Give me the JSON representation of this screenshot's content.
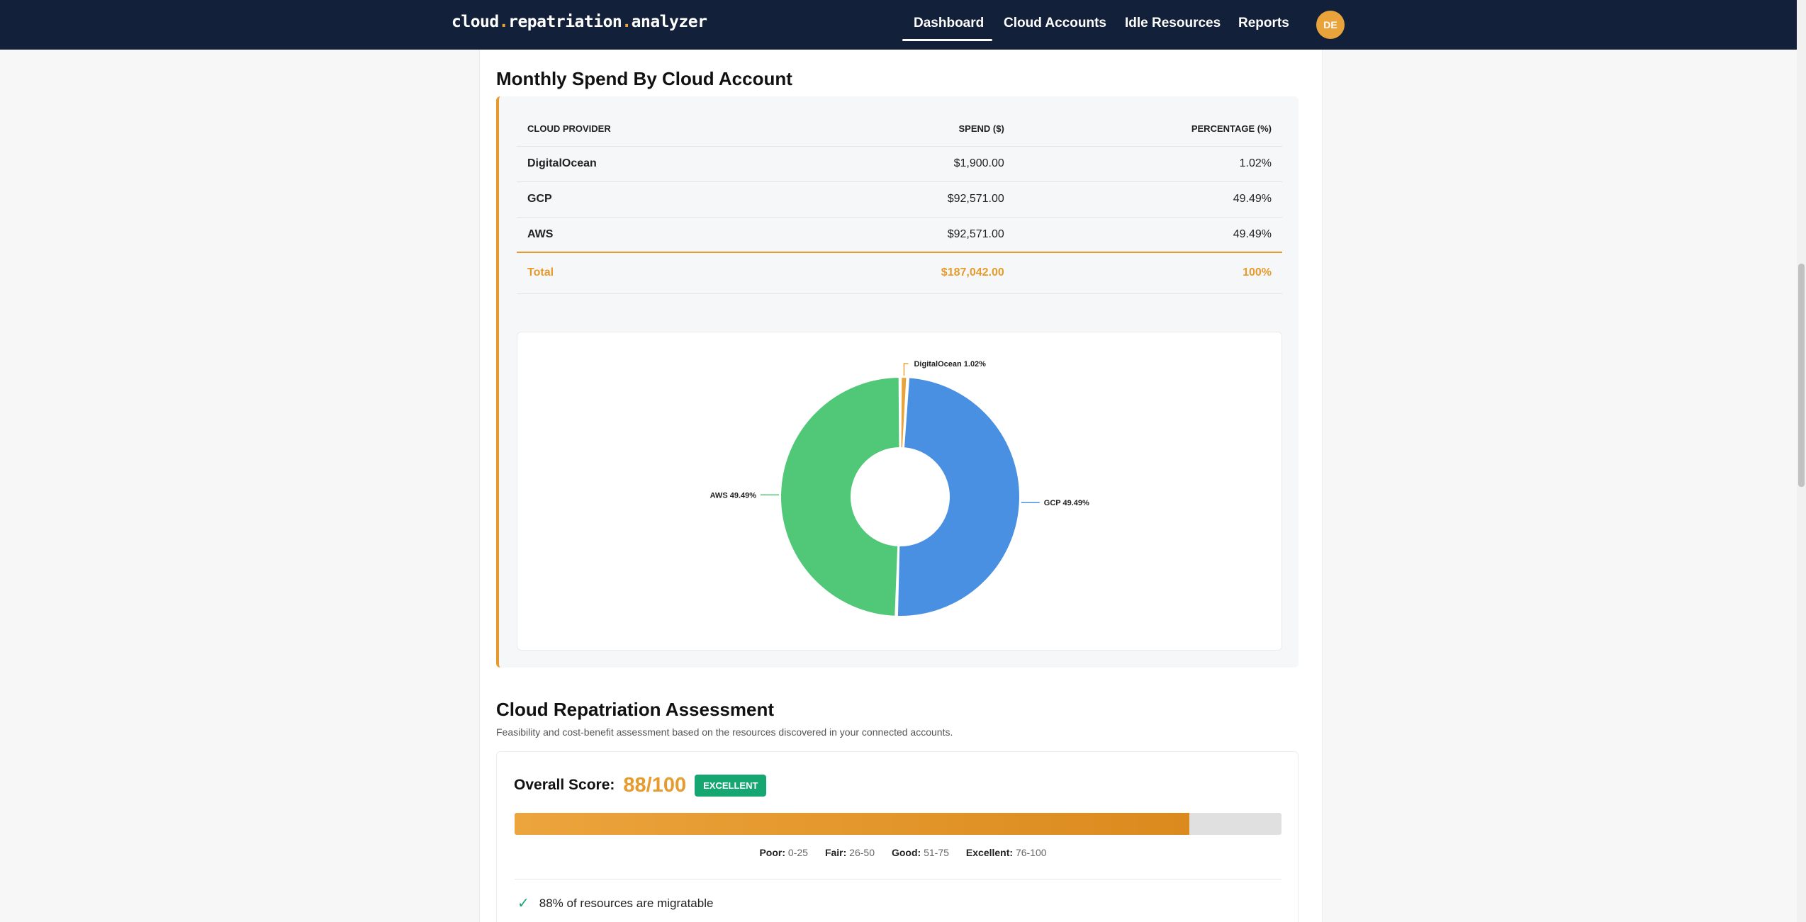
{
  "nav": {
    "brand_parts": [
      "cloud",
      ".",
      "repatriation",
      ".",
      "analyzer"
    ],
    "links": [
      "Dashboard",
      "Cloud Accounts",
      "Idle Resources",
      "Reports"
    ],
    "active": "Dashboard",
    "avatar_initials": "DE"
  },
  "spend": {
    "title": "Monthly Spend By Cloud Account",
    "headers": [
      "CLOUD PROVIDER",
      "SPEND ($)",
      "PERCENTAGE (%)"
    ],
    "rows": [
      {
        "provider": "DigitalOcean",
        "spend": "$1,900.00",
        "pct": "1.02%"
      },
      {
        "provider": "GCP",
        "spend": "$92,571.00",
        "pct": "49.49%"
      },
      {
        "provider": "AWS",
        "spend": "$92,571.00",
        "pct": "49.49%"
      }
    ],
    "total": {
      "label": "Total",
      "spend": "$187,042.00",
      "pct": "100%"
    }
  },
  "chart_data": {
    "type": "pie",
    "donut": true,
    "categories": [
      "DigitalOcean",
      "GCP",
      "AWS"
    ],
    "values": [
      1.02,
      49.49,
      49.49
    ],
    "slice_labels": [
      "DigitalOcean 1.02%",
      "GCP 49.49%",
      "AWS 49.49%"
    ],
    "colors": [
      "#e8a33a",
      "#4a90e2",
      "#50c878"
    ],
    "title": "",
    "legend": "none"
  },
  "assessment": {
    "title": "Cloud Repatriation Assessment",
    "subtitle": "Feasibility and cost-benefit assessment based on the resources discovered in your connected accounts.",
    "score_label": "Overall Score:",
    "score_text": "88/100",
    "score_value": 88,
    "badge": "EXCELLENT",
    "scale": [
      {
        "label": "Poor:",
        "range": "0-25"
      },
      {
        "label": "Fair:",
        "range": "26-50"
      },
      {
        "label": "Good:",
        "range": "51-75"
      },
      {
        "label": "Excellent:",
        "range": "76-100"
      }
    ],
    "findings": [
      "88% of resources are migratable"
    ]
  },
  "colors": {
    "nav_bg": "#13203a",
    "accent": "#e69b2c",
    "success": "#16a672"
  }
}
